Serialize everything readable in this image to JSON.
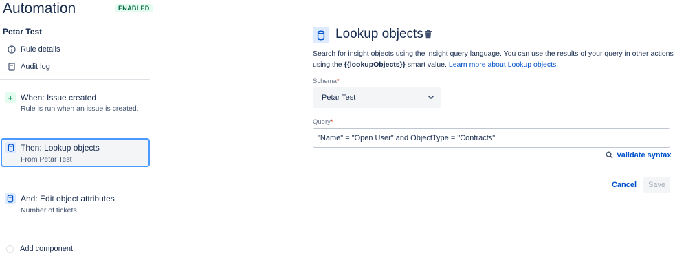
{
  "app": {
    "title": "Automation",
    "status_badge": "ENABLED"
  },
  "rule": {
    "name": "Petar Test"
  },
  "sidebar": {
    "links": [
      {
        "label": "Rule details",
        "icon": "info-icon"
      },
      {
        "label": "Audit log",
        "icon": "document-icon"
      }
    ],
    "steps": [
      {
        "title": "When: Issue created",
        "subtitle": "Rule is run when an issue is created.",
        "icon": "plus-icon"
      },
      {
        "title": "Then: Lookup objects",
        "subtitle": "From Petar Test",
        "icon": "database-icon",
        "selected": true
      },
      {
        "title": "And: Edit object attributes",
        "subtitle": "Number of tickets",
        "icon": "database-icon"
      }
    ],
    "add_component": "Add component"
  },
  "panel": {
    "title": "Lookup objects",
    "description": {
      "part1": "Search for insight objects using the insight query language. You can use the results of your query in other actions using the ",
      "code": "{{lookupObjects}}",
      "part2": " smart value. ",
      "link": "Learn more about Lookup objects."
    },
    "schema": {
      "label": "Schema",
      "required_mark": "*",
      "value": "Petar Test"
    },
    "query": {
      "label": "Query",
      "required_mark": "*",
      "value": "\"Name\" = \"Open User\" and ObjectType = \"Contracts\""
    },
    "validate_label": "Validate syntax",
    "cancel_label": "Cancel",
    "save_label": "Save"
  },
  "colors": {
    "accent": "#0052cc",
    "selected_border": "#4c9aff",
    "enabled_green": "#006644",
    "required_red": "#de350b"
  }
}
